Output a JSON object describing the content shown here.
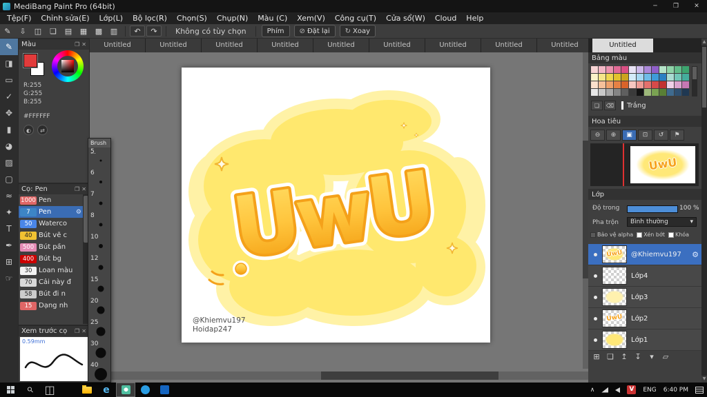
{
  "window": {
    "title": "MediBang Paint Pro (64bit)"
  },
  "menu": {
    "items": [
      "Tệp(F)",
      "Chỉnh sửa(E)",
      "Lớp(L)",
      "Bộ lọc(R)",
      "Chọn(S)",
      "Chụp(N)",
      "Màu (C)",
      "Xem(V)",
      "Công cụ(T)",
      "Cửa sổ(W)",
      "Cloud",
      "Help"
    ]
  },
  "toolbar": {
    "icons": [
      {
        "name": "new-canvas-icon",
        "glyph": "✎"
      },
      {
        "name": "save-icon",
        "glyph": "⇩"
      },
      {
        "name": "comment-icon",
        "glyph": "◫"
      },
      {
        "name": "message-icon",
        "glyph": "❏"
      },
      {
        "name": "document-icon",
        "glyph": "▤"
      },
      {
        "name": "grid-pencil-icon",
        "glyph": "▦"
      },
      {
        "name": "grid-icon",
        "glyph": "▩"
      },
      {
        "name": "cell-grid-icon",
        "glyph": "▥"
      }
    ],
    "undo_icon": "↶",
    "redo_icon": "↷",
    "no_option_label": "Không có tùy chọn",
    "buttons": [
      {
        "name": "phim-button",
        "label": "Phím",
        "glyph": ""
      },
      {
        "name": "dat-lai-button",
        "label": "Đặt lại",
        "glyph": "⊘"
      },
      {
        "name": "xoay-button",
        "label": "Xoay",
        "glyph": "↻"
      }
    ]
  },
  "tools": [
    {
      "name": "pen-tool",
      "glyph": "✎"
    },
    {
      "name": "eraser-tool",
      "glyph": "◨"
    },
    {
      "name": "select-tool",
      "glyph": "▭"
    },
    {
      "name": "operation-tool",
      "glyph": "✓"
    },
    {
      "name": "move-tool",
      "glyph": "✥"
    },
    {
      "name": "fill-rect-tool",
      "glyph": "▮"
    },
    {
      "name": "bucket-tool",
      "glyph": "◕"
    },
    {
      "name": "gradient-tool",
      "glyph": "▨"
    },
    {
      "name": "select-area-tool",
      "glyph": "▢"
    },
    {
      "name": "lasso-tool",
      "glyph": "≈"
    },
    {
      "name": "magic-wand-tool",
      "glyph": "✦"
    },
    {
      "name": "text-tool",
      "glyph": "T"
    },
    {
      "name": "eyedropper-tool",
      "glyph": "✒"
    },
    {
      "name": "divide-tool",
      "glyph": "⊞"
    },
    {
      "name": "hand-tool",
      "glyph": "☞"
    }
  ],
  "tabs": {
    "items": [
      "Untitled",
      "Untitled",
      "Untitled",
      "Untitled",
      "Untitled",
      "Untitled",
      "Untitled",
      "Untitled",
      "Untitled"
    ],
    "active_label": "Untitled"
  },
  "color_panel": {
    "title": "Màu",
    "r": "R:255",
    "g": "G:255",
    "b": "B:255",
    "hex": "#FFFFFF",
    "foreground": "#e23b3b",
    "background": "#ffffff"
  },
  "brush_panel": {
    "title": "Cọ: Pen",
    "items": [
      {
        "size": "1000",
        "name": "Pen",
        "color": "#e06666",
        "dark_text": false,
        "selected": false
      },
      {
        "size": "7",
        "name": "Pen",
        "color": "#3d85c6",
        "dark_text": false,
        "selected": true
      },
      {
        "size": "50",
        "name": "Waterco",
        "color": "#4a86e8",
        "dark_text": false,
        "selected": false
      },
      {
        "size": "40",
        "name": "Bút vẽ c",
        "color": "#f1c232",
        "dark_text": true,
        "selected": false
      },
      {
        "size": "500",
        "name": "Bút pần",
        "color": "#e58bb5",
        "dark_text": false,
        "selected": false
      },
      {
        "size": "400",
        "name": "Bút bg",
        "color": "#cc0000",
        "dark_text": false,
        "selected": false
      },
      {
        "size": "30",
        "name": "Loan màu",
        "color": "#f3f3f3",
        "dark_text": true,
        "selected": false
      },
      {
        "size": "70",
        "name": "Cải này đ",
        "color": "#d9d9d9",
        "dark_text": true,
        "selected": false
      },
      {
        "size": "58",
        "name": "Bút đi n",
        "color": "#cccccc",
        "dark_text": true,
        "selected": false
      },
      {
        "size": "15",
        "name": "Dạng nh",
        "color": "#e06666",
        "dark_text": false,
        "selected": false
      }
    ]
  },
  "brush_sizes": {
    "title": "Brush ...",
    "items": [
      {
        "label": "5",
        "dot": 3
      },
      {
        "label": "6",
        "dot": 4
      },
      {
        "label": "7",
        "dot": 5
      },
      {
        "label": "8",
        "dot": 5
      },
      {
        "label": "10",
        "dot": 6
      },
      {
        "label": "12",
        "dot": 7
      },
      {
        "label": "15",
        "dot": 9
      },
      {
        "label": "20",
        "dot": 11
      },
      {
        "label": "25",
        "dot": 13
      },
      {
        "label": "30",
        "dot": 15
      },
      {
        "label": "40",
        "dot": 18
      }
    ]
  },
  "preview_panel": {
    "title": "Xem trước cọ",
    "size_label": "0.59mm"
  },
  "palette_panel": {
    "title": "Bảng màu",
    "selected_label": "Trắng",
    "rows": [
      [
        "#f7d4d4",
        "#f2b8c6",
        "#eb93af",
        "#e16a96",
        "#d94f83",
        "#e8e3f5",
        "#cdb9ea",
        "#ab88d8",
        "#8f5fc8",
        "#b5e3c8",
        "#8fd3a8",
        "#62bd8a",
        "#3da56f"
      ],
      [
        "#fbf3c9",
        "#f5e68a",
        "#eed750",
        "#e3c22e",
        "#cba31f",
        "#d4ecf9",
        "#a6d8f2",
        "#6fbce8",
        "#3f9bd9",
        "#2b7fc2",
        "#aadcd2",
        "#72c7b8",
        "#45ad9c"
      ],
      [
        "#fbe0cc",
        "#f5c09a",
        "#eea06b",
        "#e68145",
        "#d9632a",
        "#f6c6c0",
        "#ee9b95",
        "#e4716d",
        "#d74a4a",
        "#c13232",
        "#f0d0e8",
        "#dba4cf",
        "#c678b4"
      ],
      [
        "#e8e8e8",
        "#c9c9c9",
        "#a8a8a8",
        "#858585",
        "#5f5f5f",
        "#3a3a3a",
        "#141414",
        "#9db87a",
        "#7aa352",
        "#597f35",
        "#3f6b8f",
        "#2f5070",
        "#1f3852"
      ]
    ]
  },
  "navigator": {
    "title": "Hoa tiêu",
    "buttons": [
      {
        "name": "zoom-out-button",
        "glyph": "⊖",
        "active": false
      },
      {
        "name": "zoom-in-button",
        "glyph": "⊕",
        "active": false
      },
      {
        "name": "fit-window-button",
        "glyph": "▣",
        "active": true
      },
      {
        "name": "zoom-reset-button",
        "glyph": "⊡",
        "active": false
      },
      {
        "name": "rotate-reset-button",
        "glyph": "↺",
        "active": false
      },
      {
        "name": "flag-button",
        "glyph": "⚑",
        "active": false
      }
    ]
  },
  "layer_panel": {
    "title": "Lớp",
    "opacity_label": "Độ trong",
    "opacity_value": "100 %",
    "blend_label": "Pha trộn",
    "blend_value": "Bình thường",
    "alpha_label": "Bảo vệ alpha",
    "clip_label": "Xén bớt",
    "lock_label": "Khóa",
    "layers": [
      {
        "name": "@Khiemvu197",
        "thumb": "art",
        "selected": true
      },
      {
        "name": "Lớp4",
        "thumb": "empty",
        "selected": false
      },
      {
        "name": "Lớp3",
        "thumb": "blob_light",
        "selected": false
      },
      {
        "name": "Lớp2",
        "thumb": "text",
        "selected": false
      },
      {
        "name": "Lớp1",
        "thumb": "blob",
        "selected": false
      }
    ],
    "buttons": [
      {
        "name": "add-layer-button",
        "glyph": "⊞"
      },
      {
        "name": "duplicate-layer-button",
        "glyph": "❏"
      },
      {
        "name": "layer-up-button",
        "glyph": "↥"
      },
      {
        "name": "merge-layer-button",
        "glyph": "↧"
      },
      {
        "name": "layer-menu-arrow",
        "glyph": "▾"
      },
      {
        "name": "layer-folder-button",
        "glyph": "▱"
      }
    ]
  },
  "canvas": {
    "artwork_text": "UwU",
    "signature_line1": "@Khiemvu197",
    "signature_line2": "Hoidap247"
  },
  "taskbar": {
    "language": "ENG",
    "time": "6:40 PM"
  }
}
